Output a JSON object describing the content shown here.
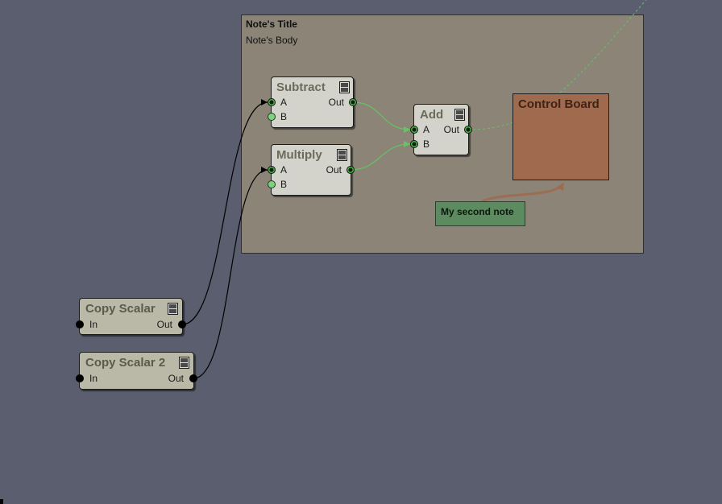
{
  "canvas": {
    "background": "#5a5e6e"
  },
  "group_note": {
    "title": "Note's Title",
    "body": "Note's Body",
    "color": "#8b8477"
  },
  "control_board": {
    "title": "Control Board",
    "color": "#a06a4f"
  },
  "second_note": {
    "text": "My second note",
    "color": "#5b8b5f"
  },
  "wire_colors": {
    "scalar": "#000000",
    "float": "#63c463",
    "note_link": "#a0694c"
  },
  "nodes": {
    "subtract": {
      "title": "Subtract",
      "icon": "node-menu-icon",
      "color": "#d3d3cb",
      "inputs": [
        {
          "label": "A",
          "connected": true
        },
        {
          "label": "B",
          "connected": false
        }
      ],
      "output": {
        "label": "Out",
        "connected": true
      }
    },
    "multiply": {
      "title": "Multiply",
      "icon": "node-menu-icon",
      "color": "#d3d3cb",
      "inputs": [
        {
          "label": "A",
          "connected": true
        },
        {
          "label": "B",
          "connected": false
        }
      ],
      "output": {
        "label": "Out",
        "connected": true
      }
    },
    "add": {
      "title": "Add",
      "icon": "node-menu-icon",
      "color": "#d3d3cb",
      "inputs": [
        {
          "label": "A",
          "connected": true
        },
        {
          "label": "B",
          "connected": true
        }
      ],
      "output": {
        "label": "Out",
        "connected": true
      }
    },
    "copy_scalar": {
      "title": "Copy Scalar",
      "icon": "node-menu-icon",
      "color": "#bab8a6",
      "inputs": [
        {
          "label": "In",
          "connected": false
        }
      ],
      "output": {
        "label": "Out",
        "connected": true
      }
    },
    "copy_scalar_2": {
      "title": "Copy Scalar 2",
      "icon": "node-menu-icon",
      "color": "#bab8a6",
      "inputs": [
        {
          "label": "In",
          "connected": false
        }
      ],
      "output": {
        "label": "Out",
        "connected": true
      }
    }
  }
}
